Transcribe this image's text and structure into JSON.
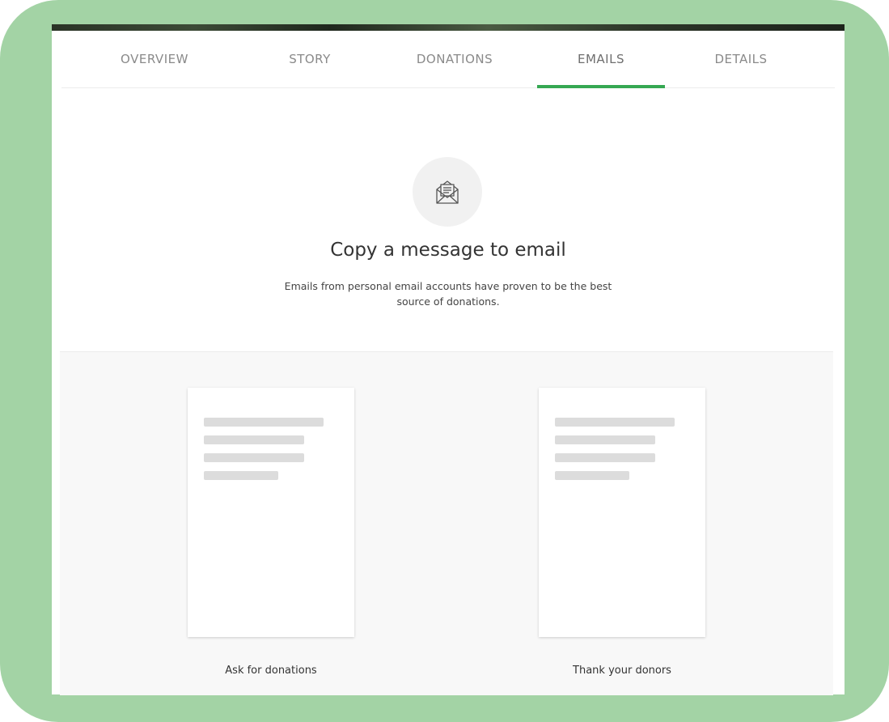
{
  "tabs": [
    {
      "label": "OVERVIEW",
      "active": false
    },
    {
      "label": "STORY",
      "active": false
    },
    {
      "label": "DONATIONS",
      "active": false
    },
    {
      "label": "EMAILS",
      "active": true
    },
    {
      "label": "DETAILS",
      "active": false
    }
  ],
  "accent_color": "#35a852",
  "frame_color": "#a3d3a5",
  "hero": {
    "icon": "envelope-letter-icon",
    "title": "Copy a message to email",
    "subtitle": "Emails from personal email accounts have proven to be the best source of donations."
  },
  "templates": [
    {
      "label": "Ask for donations"
    },
    {
      "label": "Thank your donors"
    }
  ]
}
